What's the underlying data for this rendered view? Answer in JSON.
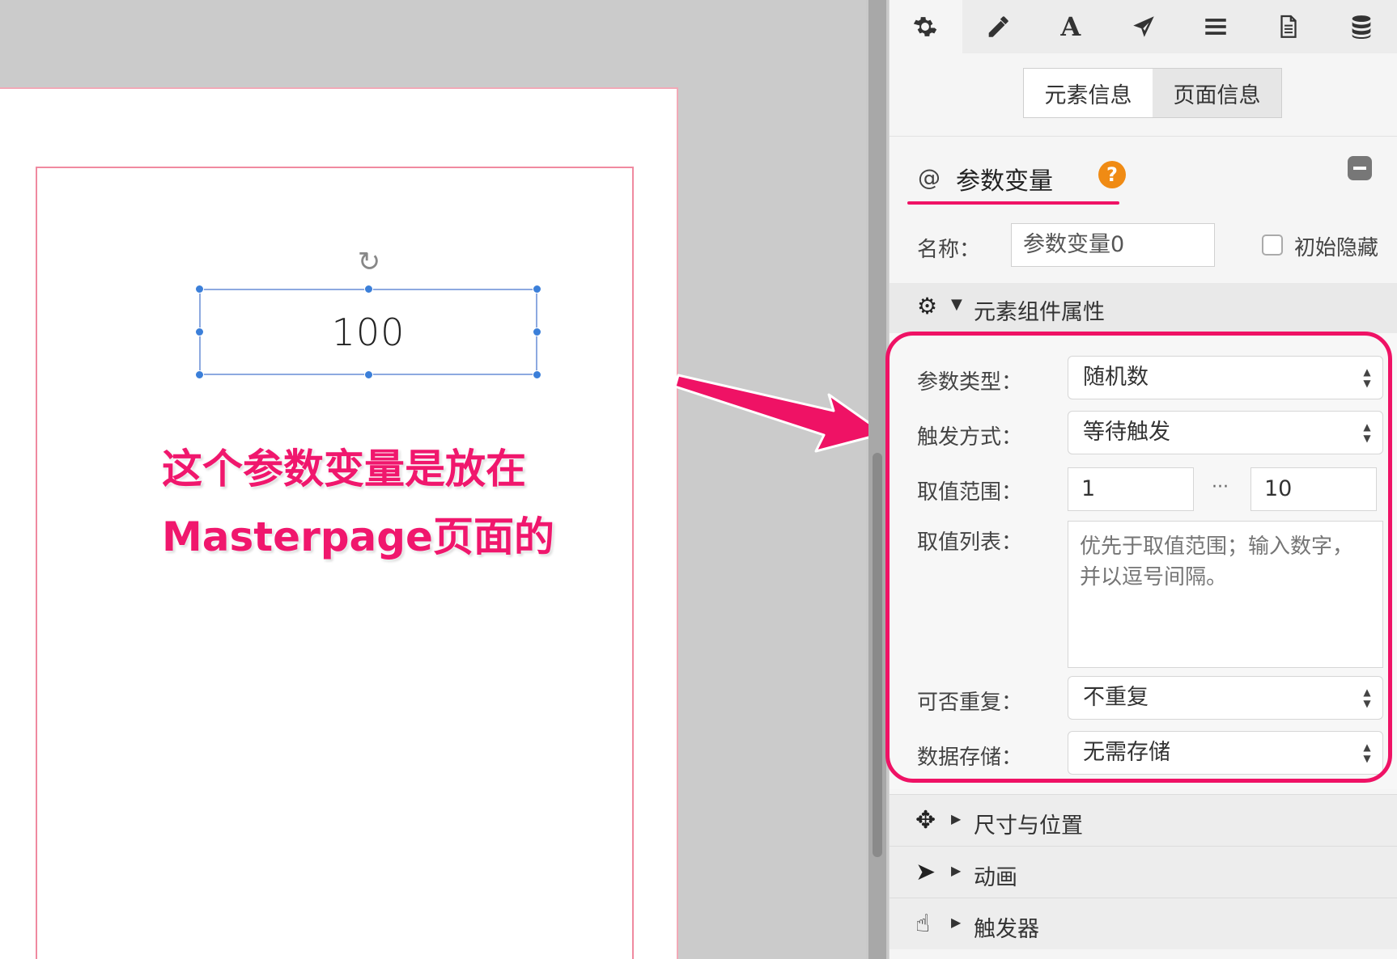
{
  "canvas": {
    "element_value": "100",
    "annotation_line1": "这个参数变量是放在",
    "annotation_line2": "Masterpage页面的"
  },
  "toolbar": {
    "tools": [
      {
        "icon": "gear-icon",
        "active": true
      },
      {
        "icon": "pencil-icon"
      },
      {
        "icon": "text-icon",
        "glyph": "A"
      },
      {
        "icon": "send-icon"
      },
      {
        "icon": "menu-icon"
      },
      {
        "icon": "document-icon"
      },
      {
        "icon": "database-icon"
      }
    ]
  },
  "info_tabs": {
    "element_info": "元素信息",
    "page_info": "页面信息"
  },
  "section": {
    "icon": "@",
    "title": "参数变量",
    "help": "?"
  },
  "name_row": {
    "label": "名称：",
    "value": "参数变量0",
    "initially_hidden_label": "初始隐藏",
    "initially_hidden_checked": false
  },
  "props": {
    "title": "元素组件属性",
    "param_type_label": "参数类型：",
    "param_type_value": "随机数",
    "trigger_mode_label": "触发方式：",
    "trigger_mode_value": "等待触发",
    "range_label": "取值范围：",
    "range_min": "1",
    "range_sep": "···",
    "range_max": "10",
    "value_list_label": "取值列表：",
    "value_list_placeholder": "优先于取值范围；输入数字，并以逗号间隔。",
    "repeat_label": "可否重复：",
    "repeat_value": "不重复",
    "storage_label": "数据存储：",
    "storage_value": "无需存储"
  },
  "collapsed_sections": {
    "size_position": "尺寸与位置",
    "animation": "动画",
    "trigger": "触发器"
  },
  "colors": {
    "accent": "#ef1265",
    "help": "#f08b14",
    "selection": "#3b7fd9"
  }
}
